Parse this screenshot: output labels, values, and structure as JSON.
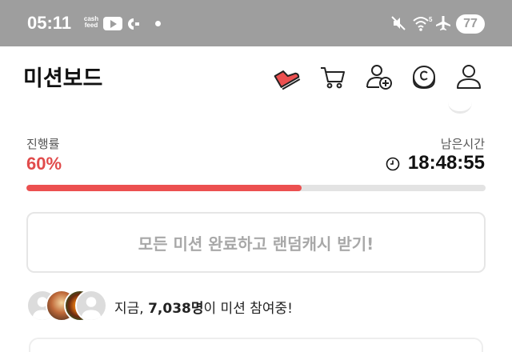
{
  "status_bar": {
    "time": "05:11",
    "cashfeed_line1": "cash",
    "cashfeed_line2": "feed",
    "battery": "77",
    "icons": [
      "cashfeed-icon",
      "youtube-icon",
      "app-icon",
      "notification-dot-icon",
      "mute-icon",
      "wifi-icon",
      "airplane-icon",
      "battery-icon"
    ]
  },
  "header": {
    "title": "미션보드",
    "icons": [
      "shoe-icon",
      "cart-icon",
      "add-friend-icon",
      "coin-icon",
      "profile-icon"
    ]
  },
  "progress": {
    "label": "진행률",
    "value_text": "60%",
    "fraction": 0.6,
    "time_label": "남은시간",
    "time_value": "18:48:55"
  },
  "reward_button": {
    "label": "모든 미션 완료하고 랜덤캐시 받기!"
  },
  "participants": {
    "prefix": "지금, ",
    "count": "7,038명",
    "suffix": "이 미션 참여중!"
  },
  "colors": {
    "accent": "#ec5050",
    "status_bar": "#9e9e9e",
    "muted_text": "#a8a8a8"
  }
}
